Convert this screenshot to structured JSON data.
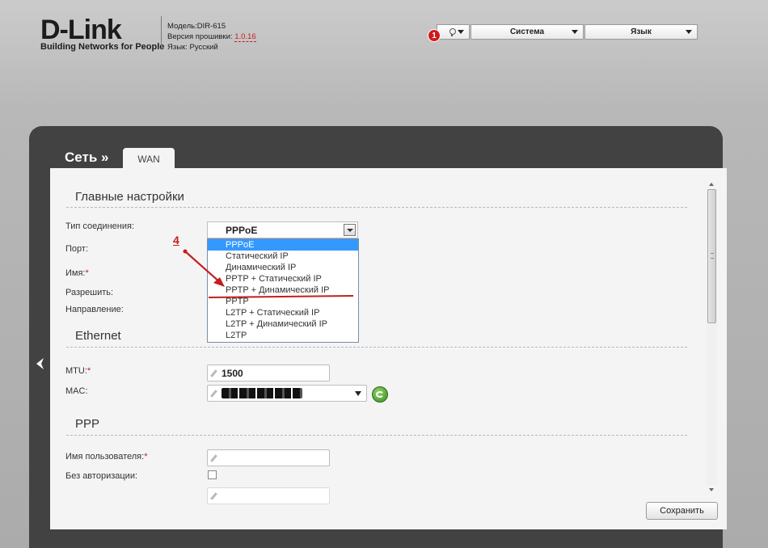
{
  "header": {
    "logo": {
      "brand": "D-Link",
      "tagline": "Building Networks for People"
    },
    "device_info": {
      "model_label": "Модель:",
      "model_value": "DIR-615",
      "firmware_label": "Версия прошивки:",
      "firmware_value": "1.0.16",
      "language_label": "Язык:",
      "language_value": "Русский"
    },
    "notifications": {
      "icon": "lightbulb-icon",
      "count": "1"
    },
    "menu": {
      "system_label": "Система",
      "language_label": "Язык"
    }
  },
  "panel": {
    "breadcrumb": "Сеть »",
    "tab_label": "WAN"
  },
  "main_settings": {
    "title": "Главные настройки",
    "connection_type_label": "Тип соединения:",
    "connection_type_value": "PPPoE",
    "connection_type_options": [
      "PPPoE",
      "Статический IP",
      "Динамический IP",
      "PPTP + Статический IP",
      "PPTP + Динамический IP",
      "PPTP",
      "L2TP + Статический IP",
      "L2TP + Динамический IP",
      "L2TP"
    ],
    "port_label": "Порт:",
    "name_label": "Имя:",
    "allow_label": "Разрешить:",
    "direction_label": "Направление:"
  },
  "ethernet": {
    "title": "Ethernet",
    "mtu_label": "MTU:",
    "mtu_value": "1500",
    "mac_label": "MAC:"
  },
  "ppp": {
    "title": "PPP",
    "username_label": "Имя пользователя:",
    "no_auth_label": "Без авторизации:"
  },
  "actions": {
    "save_label": "Сохранить"
  },
  "annotation": {
    "step": "4",
    "color": "#c41e1e"
  },
  "colors": {
    "panel": "#424242",
    "content": "#f4f4f4",
    "selection": "#3399ff",
    "required": "#c41e1e"
  }
}
